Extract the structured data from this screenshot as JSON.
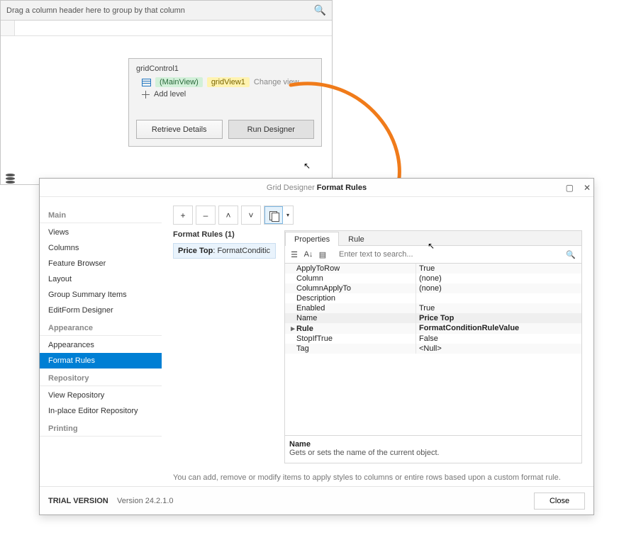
{
  "bgPanel": {
    "groupHint": "Drag a column header here to group by that column",
    "searchIcon": "🔍"
  },
  "smartTag": {
    "title": "gridControl1",
    "mainView": "(MainView)",
    "gridView": "gridView1",
    "changeView": "Change view",
    "addLevel": "Add level",
    "retrieve": "Retrieve Details",
    "runDesigner": "Run Designer"
  },
  "designer": {
    "titleWeak": "Grid Designer",
    "titleStrong": "Format Rules",
    "sidebar": {
      "main": "Main",
      "mainItems": [
        "Views",
        "Columns",
        "Feature Browser",
        "Layout",
        "Group Summary Items",
        "EditForm Designer"
      ],
      "appearance": "Appearance",
      "appearanceItems": [
        "Appearances",
        "Format Rules"
      ],
      "repository": "Repository",
      "repositoryItems": [
        "View Repository",
        "In-place Editor Repository"
      ],
      "printing": "Printing"
    },
    "toolbar": {
      "add": "+",
      "remove": "–",
      "up": "˄",
      "down": "˅"
    },
    "rules": {
      "heading": "Format Rules (1)",
      "items": [
        {
          "label": "Price Top",
          "type": "FormatConditic"
        }
      ]
    },
    "tabs": {
      "properties": "Properties",
      "rule": "Rule"
    },
    "searchPlaceholder": "Enter text to search...",
    "props": [
      {
        "name": "ApplyToRow",
        "value": "True"
      },
      {
        "name": "Column",
        "value": "(none)"
      },
      {
        "name": "ColumnApplyTo",
        "value": "(none)"
      },
      {
        "name": "Description",
        "value": ""
      },
      {
        "name": "Enabled",
        "value": "True"
      },
      {
        "name": "Name",
        "value": "Price Top",
        "selected": true
      },
      {
        "name": "Rule",
        "value": "FormatConditionRuleValue",
        "bold": true,
        "arrow": true
      },
      {
        "name": "StopIfTrue",
        "value": "False"
      },
      {
        "name": "Tag",
        "value": "<Null>"
      }
    ],
    "help": {
      "name": "Name",
      "desc": "Gets or sets the name of the current object."
    },
    "hint": "You can add, remove or modify items to apply styles to columns or entire rows based upon a custom format rule.",
    "footer": {
      "trial": "TRIAL VERSION",
      "version": "Version 24.2.1.0",
      "close": "Close"
    }
  }
}
